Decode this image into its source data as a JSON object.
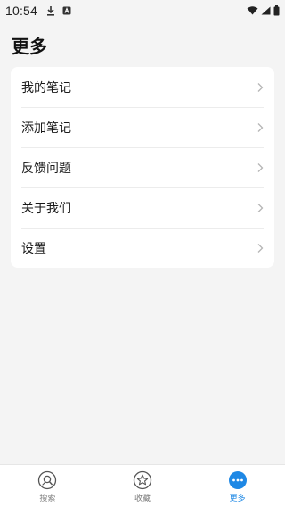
{
  "status_bar": {
    "time": "10:54",
    "left_icons": [
      "download-icon",
      "notification-a-icon"
    ],
    "right_icons": [
      "wifi-icon",
      "signal-icon",
      "battery-icon"
    ]
  },
  "page": {
    "title": "更多"
  },
  "menu": {
    "items": [
      {
        "label": "我的笔记",
        "icon": "chevron-right-icon"
      },
      {
        "label": "添加笔记",
        "icon": "chevron-right-icon"
      },
      {
        "label": "反馈问题",
        "icon": "chevron-right-icon"
      },
      {
        "label": "关于我们",
        "icon": "chevron-right-icon"
      },
      {
        "label": "设置",
        "icon": "chevron-right-icon"
      }
    ]
  },
  "bottom_nav": {
    "tabs": [
      {
        "label": "搜索",
        "icon": "search-icon",
        "active": false
      },
      {
        "label": "收藏",
        "icon": "star-icon",
        "active": false
      },
      {
        "label": "更多",
        "icon": "more-icon",
        "active": true
      }
    ]
  },
  "colors": {
    "accent": "#1e88e5",
    "background": "#f4f4f4",
    "card": "#ffffff",
    "inactive": "#7a7a7a"
  }
}
